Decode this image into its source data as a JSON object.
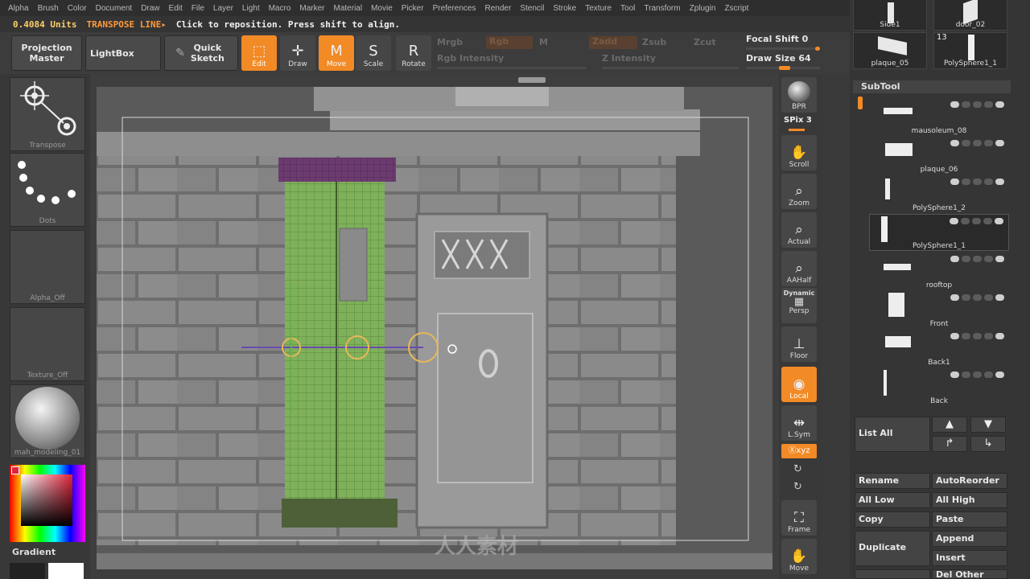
{
  "menu": [
    "Alpha",
    "Brush",
    "Color",
    "Document",
    "Draw",
    "Edit",
    "File",
    "Layer",
    "Light",
    "Macro",
    "Marker",
    "Material",
    "Movie",
    "Picker",
    "Preferences",
    "Render",
    "Stencil",
    "Stroke",
    "Texture",
    "Tool",
    "Transform",
    "Zplugin",
    "Zscript"
  ],
  "status": {
    "units": "0.4084 Units",
    "mode": "TRANSPOSE LINE▸",
    "hint": "Click to reposition. Press shift to align."
  },
  "shelf": {
    "projection_master": "Projection Master",
    "lightbox": "LightBox",
    "quick_sketch": "Quick Sketch",
    "edit": "Edit",
    "draw": "Draw",
    "move": "Move",
    "scale": "Scale",
    "rotate": "Rotate",
    "mrgb": "Mrgb",
    "rgb": "Rgb",
    "m": "M",
    "zadd": "Zadd",
    "zsub": "Zsub",
    "zcut": "Zcut",
    "rgb_intensity": "Rgb Intensity",
    "z_intensity": "Z Intensity",
    "focal_shift_label": "Focal Shift",
    "focal_shift_value": "0",
    "draw_size_label": "Draw Size",
    "draw_size_value": "64"
  },
  "left": {
    "transpose_caption": "Transpose",
    "dots_caption": "Dots",
    "alpha_caption": "Alpha_Off",
    "texture_caption": "Texture_Off",
    "material_caption": "mah_modeling_01",
    "gradient_label": "Gradient"
  },
  "rightstrip": {
    "bpr": "BPR",
    "spix_label": "SPix",
    "spix_value": "3",
    "scroll": "Scroll",
    "zoom": "Zoom",
    "actual": "Actual",
    "aahalf": "AAHalf",
    "dynamic": "Dynamic",
    "persp": "Persp",
    "floor": "Floor",
    "local": "Local",
    "lsym": "L.Sym",
    "xyz": "Ⓧxyz",
    "frame": "Frame",
    "move": "Move"
  },
  "tools_top": [
    {
      "name": "Side1"
    },
    {
      "name": "door_02"
    },
    {
      "name": "plaque_05"
    },
    {
      "name": "PolySphere1_1",
      "count": "13"
    }
  ],
  "subtool": {
    "title": "SubTool",
    "items": [
      "mausoleum_08",
      "plaque_06",
      "PolySphere1_2",
      "PolySphere1_1",
      "rooftop",
      "Front",
      "Back1",
      "Back"
    ],
    "selected": "PolySphere1_1"
  },
  "buttons": {
    "list_all": "List All",
    "rename": "Rename",
    "autoreorder": "AutoReorder",
    "all_low": "All Low",
    "all_high": "All High",
    "copy": "Copy",
    "paste": "Paste",
    "duplicate": "Duplicate",
    "append": "Append",
    "insert": "Insert",
    "del_other": "Del Other"
  },
  "watermark": "人人素材",
  "colors": {
    "accent": "#f28a26",
    "wall": "#7a7a7a",
    "pillar_green": "#8fb86a",
    "pillar_cap": "#6a3c6a"
  }
}
